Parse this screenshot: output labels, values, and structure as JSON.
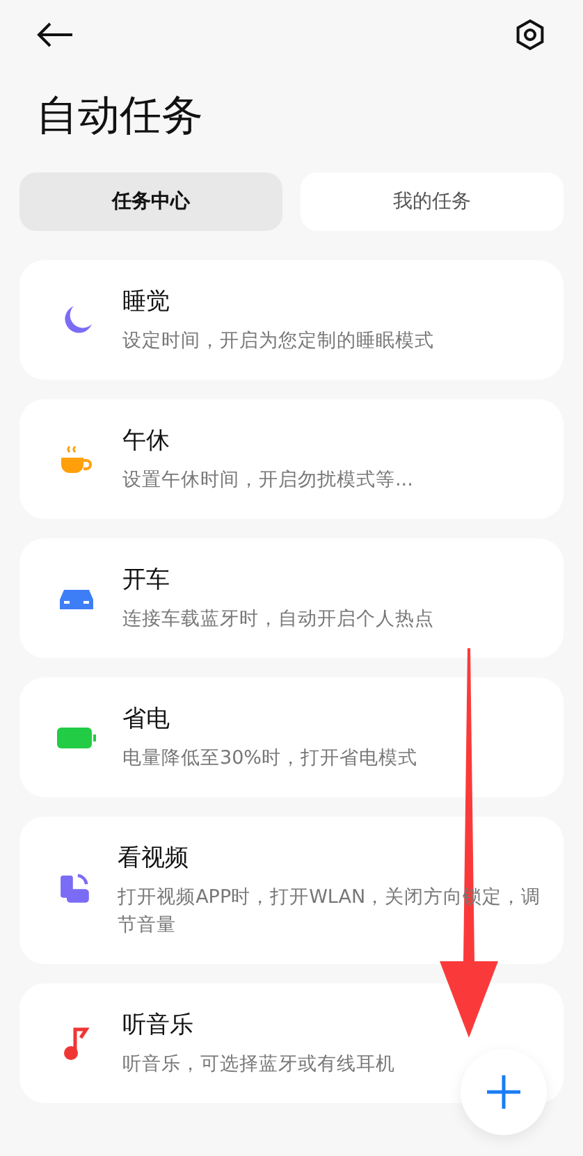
{
  "header": {
    "title": "自动任务"
  },
  "tabs": [
    {
      "label": "任务中心",
      "selected": true
    },
    {
      "label": "我的任务",
      "selected": false
    }
  ],
  "tasks": [
    {
      "kind": "moon",
      "title": "睡觉",
      "description": "设定时间，开启为您定制的睡眠模式"
    },
    {
      "kind": "cup",
      "title": "午休",
      "description": "设置午休时间，开启勿扰模式等..."
    },
    {
      "kind": "car",
      "title": "开车",
      "description": "连接车载蓝牙时，自动开启个人热点"
    },
    {
      "kind": "battery",
      "title": "省电",
      "description": "电量降低至30%时，打开省电模式"
    },
    {
      "kind": "video",
      "title": "看视频",
      "description": "打开视频APP时，打开WLAN，关闭方向锁定，调节音量"
    },
    {
      "kind": "music",
      "title": "听音乐",
      "description": "听音乐，可选择蓝牙或有线耳机"
    }
  ]
}
